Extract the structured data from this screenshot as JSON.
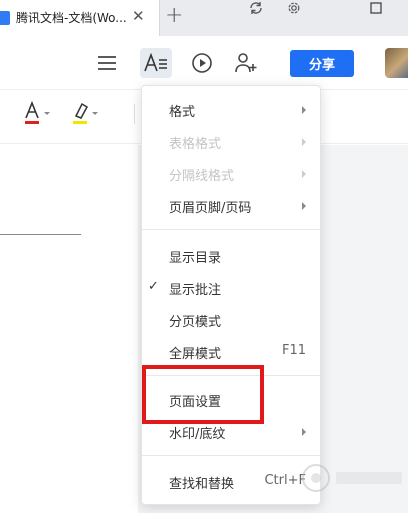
{
  "tab": {
    "title": "腾讯文档-文档(Wo..."
  },
  "toolbar": {
    "share_label": "分享"
  },
  "menu": {
    "items": [
      {
        "label": "格式",
        "has_submenu": true,
        "enabled": true
      },
      {
        "label": "表格格式",
        "has_submenu": true,
        "enabled": false
      },
      {
        "label": "分隔线格式",
        "has_submenu": true,
        "enabled": false
      },
      {
        "label": "页眉页脚/页码",
        "has_submenu": true,
        "enabled": true
      },
      {
        "label": "显示目录",
        "enabled": true
      },
      {
        "label": "显示批注",
        "checked": true,
        "enabled": true
      },
      {
        "label": "分页模式",
        "enabled": true
      },
      {
        "label": "全屏模式",
        "shortcut": "F11",
        "enabled": true
      },
      {
        "label": "页面设置",
        "enabled": true,
        "highlighted": true
      },
      {
        "label": "水印/底纹",
        "has_submenu": true,
        "enabled": true
      },
      {
        "label": "查找和替换",
        "shortcut": "Ctrl+F",
        "enabled": true
      }
    ]
  },
  "colors": {
    "accent": "#1f6ff5",
    "highlight": "#e0191b",
    "font_color_bar": "#e02020",
    "highlight_color_bar": "#f2e600"
  }
}
